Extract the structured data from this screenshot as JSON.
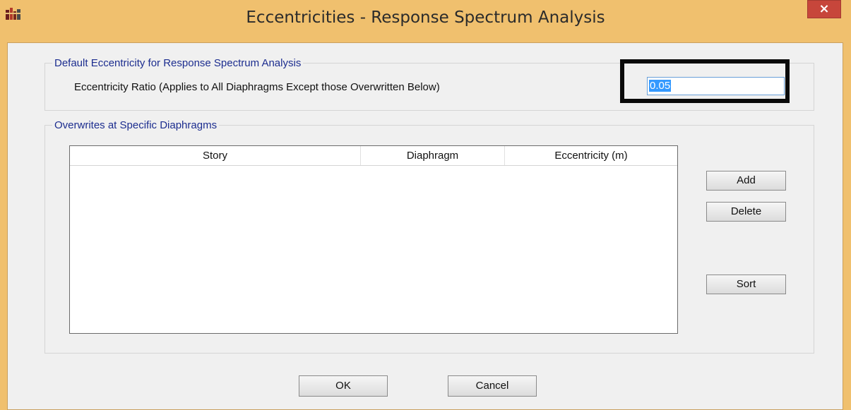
{
  "window": {
    "title": "Eccentricities - Response Spectrum Analysis",
    "close_label": "×"
  },
  "default_group": {
    "legend": "Default Eccentricity for Response Spectrum Analysis",
    "ratio_label": "Eccentricity Ratio (Applies to All Diaphragms Except those Overwritten Below)",
    "ratio_value": "0.05"
  },
  "overwrites_group": {
    "legend": "Overwrites at Specific Diaphragms",
    "columns": [
      "Story",
      "Diaphragm",
      "Eccentricity (m)"
    ],
    "rows": []
  },
  "side_buttons": {
    "add": "Add",
    "delete": "Delete",
    "sort": "Sort"
  },
  "footer": {
    "ok": "OK",
    "cancel": "Cancel"
  },
  "colors": {
    "title_bar": "#f0c06e",
    "close_button": "#c7463b",
    "legend_text": "#1c2d8f",
    "selection": "#3399ff"
  }
}
